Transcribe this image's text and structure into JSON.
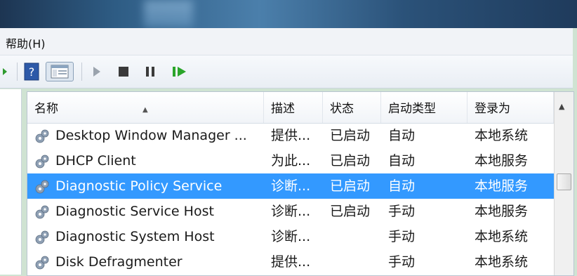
{
  "menu": {
    "help": "帮助(H)"
  },
  "toolbar": {
    "buttons": [
      "back-arrow-icon",
      "help-icon",
      "show-hide-console-tree-icon",
      "play-icon",
      "stop-icon",
      "pause-icon",
      "restart-icon"
    ]
  },
  "columns": {
    "name": "名称",
    "description": "描述",
    "status": "状态",
    "startup_type": "启动类型",
    "log_on_as": "登录为"
  },
  "rows": [
    {
      "name": "Desktop Window Manager ...",
      "description": "提供...",
      "status": "已启动",
      "startup": "自动",
      "logon": "本地系统",
      "selected": false
    },
    {
      "name": "DHCP Client",
      "description": "为此...",
      "status": "已启动",
      "startup": "自动",
      "logon": "本地服务",
      "selected": false
    },
    {
      "name": "Diagnostic Policy Service",
      "description": "诊断...",
      "status": "已启动",
      "startup": "自动",
      "logon": "本地服务",
      "selected": true
    },
    {
      "name": "Diagnostic Service Host",
      "description": "诊断...",
      "status": "已启动",
      "startup": "手动",
      "logon": "本地服务",
      "selected": false
    },
    {
      "name": "Diagnostic System Host",
      "description": "诊断...",
      "status": "",
      "startup": "手动",
      "logon": "本地系统",
      "selected": false
    },
    {
      "name": "Disk Defragmenter",
      "description": "提供...",
      "status": "",
      "startup": "手动",
      "logon": "本地系统",
      "selected": false
    }
  ],
  "colors": {
    "selection": "#3399ff",
    "accent_green": "#2aa52a"
  }
}
